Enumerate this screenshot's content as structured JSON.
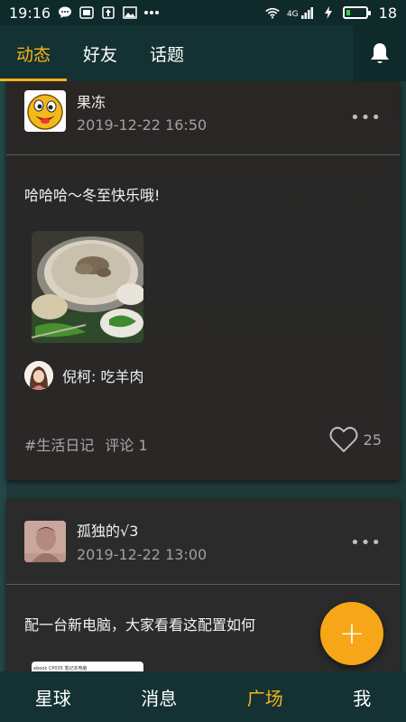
{
  "status_bar": {
    "time": "19:16",
    "network": "4G",
    "battery": "18"
  },
  "top_nav": {
    "tabs": [
      {
        "label": "动态",
        "active": true
      },
      {
        "label": "好友",
        "active": false
      },
      {
        "label": "话题",
        "active": false
      }
    ]
  },
  "posts": [
    {
      "username": "果冻",
      "time": "2019-12-22 16:50",
      "text": "哈哈哈～冬至快乐哦!",
      "reply": {
        "name": "倪柯",
        "text": "吃羊肉"
      },
      "tag": "#生活日记",
      "comments_label": "评论 1",
      "likes": "25"
    },
    {
      "username": "孤独的√3",
      "time": "2019-12-22 13:00",
      "text": "配一台新电脑，大家看看这配置如何",
      "thumb_text": "ebook CP035 笔记本电脑"
    }
  ],
  "fab_symbol": "+",
  "bottom_nav": [
    {
      "label": "星球",
      "active": false
    },
    {
      "label": "消息",
      "active": false
    },
    {
      "label": "广场",
      "active": true
    },
    {
      "label": "我",
      "active": false
    }
  ],
  "colors": {
    "accent": "#f6b31a",
    "nav_bg": "#143233",
    "card_bg": "#2b2b2b"
  }
}
